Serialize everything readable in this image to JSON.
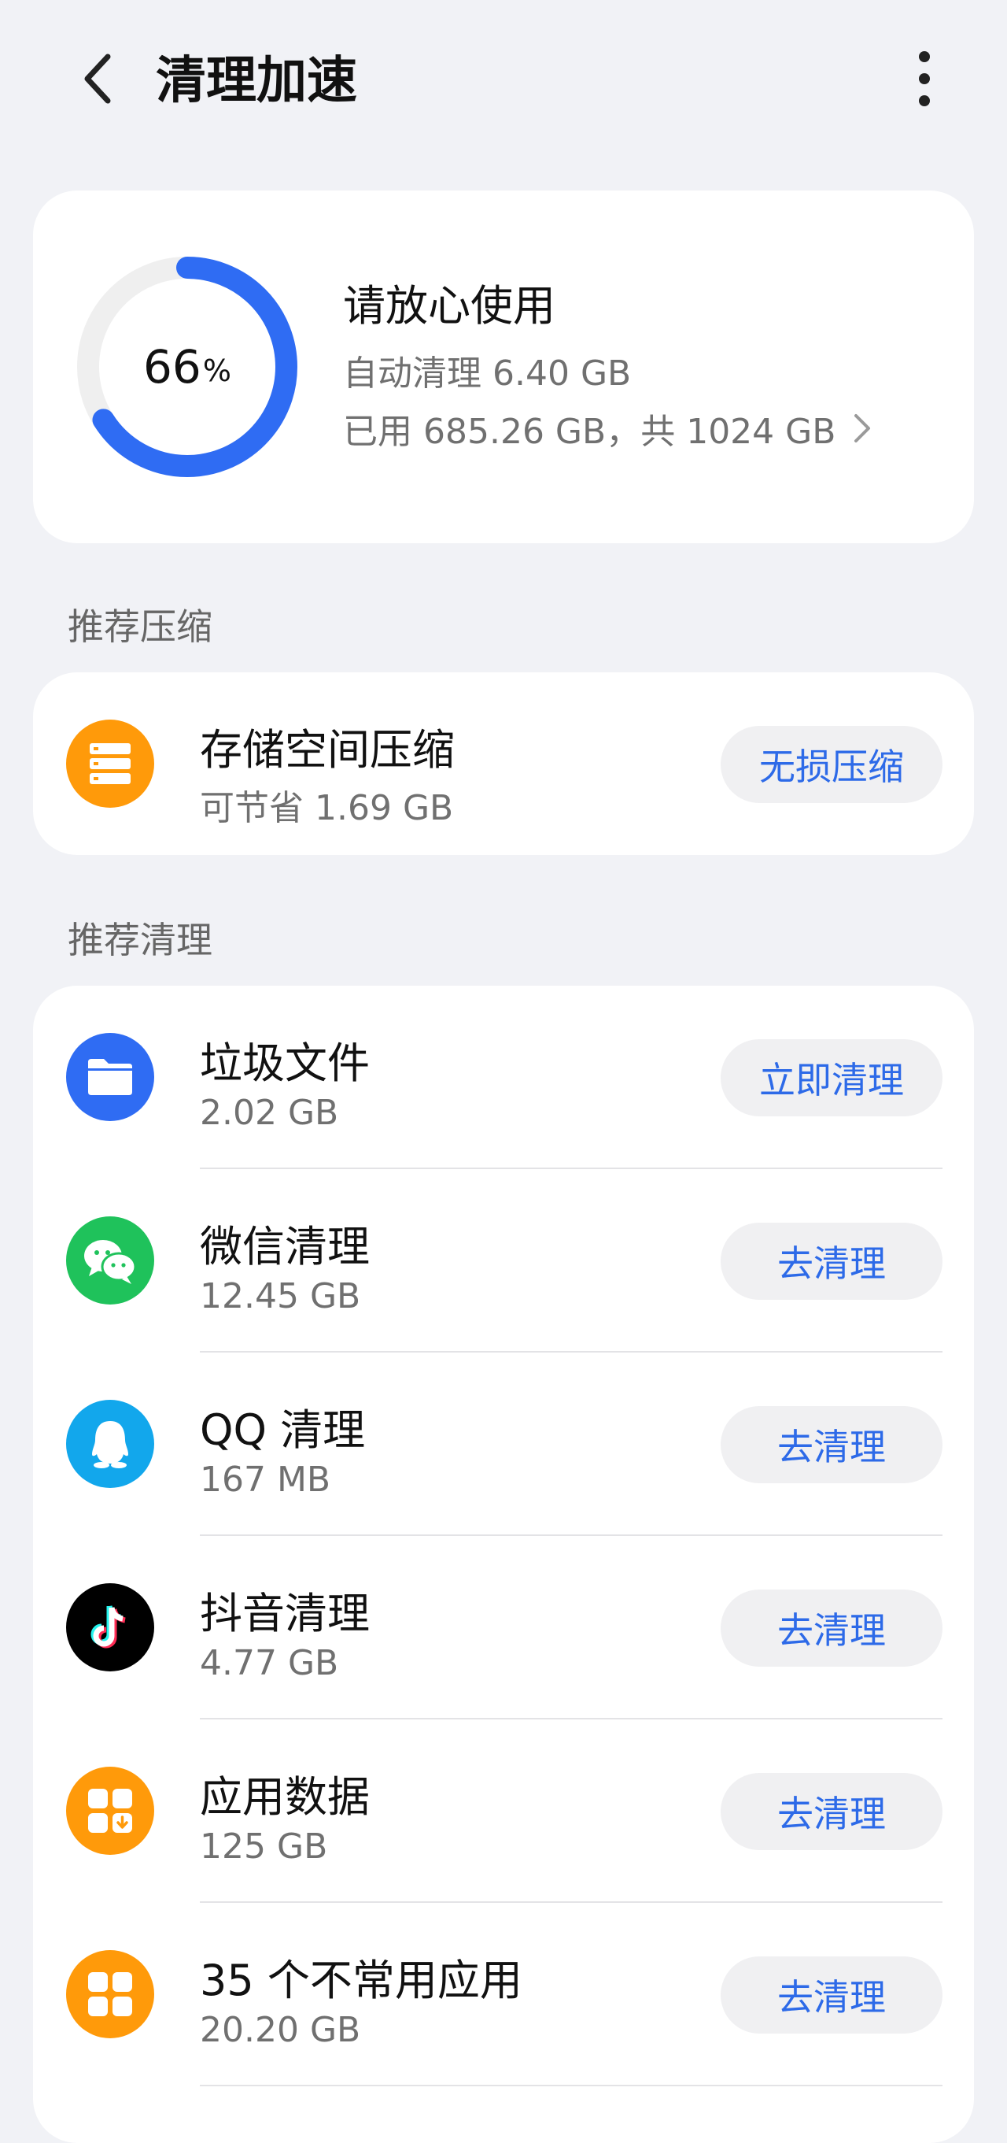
{
  "header": {
    "title": "清理加速"
  },
  "storage": {
    "used_percent": 66,
    "percent_number": "66",
    "percent_sign": "%",
    "status": "请放心使用",
    "auto_clean": "自动清理 6.40 GB",
    "usage": "已用 685.26 GB，共 1024 GB"
  },
  "sections": {
    "compress": "推荐压缩",
    "clean": "推荐清理"
  },
  "compress_item": {
    "title": "存储空间压缩",
    "subtitle": "可节省 1.69 GB",
    "button": "无损压缩"
  },
  "clean_items": [
    {
      "title": "垃圾文件",
      "size": "2.02 GB",
      "button": "立即清理",
      "icon": "folder-icon"
    },
    {
      "title": "微信清理",
      "size": "12.45 GB",
      "button": "去清理",
      "icon": "wechat-icon"
    },
    {
      "title": "QQ 清理",
      "size": "167 MB",
      "button": "去清理",
      "icon": "qq-icon"
    },
    {
      "title": "抖音清理",
      "size": "4.77 GB",
      "button": "去清理",
      "icon": "tiktok-icon"
    },
    {
      "title": "应用数据",
      "size": "125 GB",
      "button": "去清理",
      "icon": "app-data-icon"
    },
    {
      "title": "35 个不常用应用",
      "size": "20.20 GB",
      "button": "去清理",
      "icon": "apps-grid-icon"
    }
  ],
  "colors": {
    "accent": "#2d6ae8",
    "ring_track": "#efefef",
    "orange": "#ff9a0a",
    "blue": "#2f6cf3",
    "wechat_green": "#1fc25b",
    "qq_blue": "#12a7ec",
    "tiktok_black": "#000000"
  }
}
